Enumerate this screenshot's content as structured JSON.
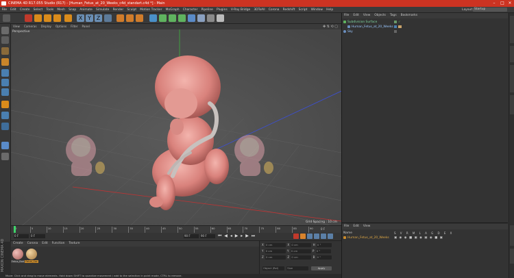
{
  "window": {
    "title": "CINEMA 4D R17.055 Studio (R17) - [Human_Fetus_at_20_Weeks_c4d_standart.c4d *] - Main",
    "buttons": [
      "minimize",
      "maximize",
      "close"
    ]
  },
  "menu": [
    "File",
    "Edit",
    "Create",
    "Select",
    "Tools",
    "Mesh",
    "Snap",
    "Animate",
    "Simulate",
    "Render",
    "Sculpt",
    "Motion Tracker",
    "MoGraph",
    "Character",
    "Pipeline",
    "Plugins",
    "V-Ray Bridge",
    "3DToAll",
    "Corona",
    "Redshift",
    "Script",
    "Window",
    "Help"
  ],
  "layout": {
    "label": "Layout:",
    "value": "Startup"
  },
  "viewport": {
    "menu": [
      "View",
      "Cameras",
      "Display",
      "Options",
      "Filter",
      "Panel"
    ],
    "label": "Perspective",
    "grid_spacing": "Grid Spacing : 10 cm"
  },
  "timeline": {
    "ticks": [
      "0",
      "5",
      "10",
      "15",
      "20",
      "25",
      "30",
      "35",
      "40",
      "45",
      "50",
      "55",
      "60",
      "65",
      "70",
      "75",
      "80",
      "85",
      "90"
    ],
    "end_frame": "0 F"
  },
  "transport": {
    "current": "0 F",
    "start": "0 F",
    "end": "90 F",
    "max": "90 F"
  },
  "object_manager": {
    "menu": [
      "File",
      "Edit",
      "View",
      "Objects",
      "Tags",
      "Bookmarks"
    ],
    "objects": [
      {
        "name": "Subdivision Surface",
        "color": "#7fd6a0"
      },
      {
        "name": "Human_Fetus_at_20_Weeks",
        "color": "#9ac7ff"
      },
      {
        "name": "Sky",
        "color": "#9ac7ff"
      }
    ]
  },
  "attribute_manager": {
    "menu": [
      "File",
      "Edit",
      "View"
    ],
    "header": "Name",
    "columns": [
      "S",
      "V",
      "R",
      "M",
      "L",
      "A",
      "G",
      "D",
      "E",
      "X"
    ],
    "layer_name": "Human_Fetus_at_20_Weeks"
  },
  "side_tabs": [
    "Objects",
    "Takes",
    "Content Browser",
    "Structure",
    "Attributes",
    "Layers"
  ],
  "material_manager": {
    "menu": [
      "Create",
      "Corona",
      "Edit",
      "Function",
      "Texture"
    ],
    "materials": [
      {
        "name": "Fetus_Bod",
        "color": "#c98b86"
      },
      {
        "name": "Fetus_Cor",
        "color": "#c9a36a"
      }
    ]
  },
  "coordinates": {
    "rows": [
      {
        "axis": "X",
        "pos": "0 cm",
        "size_axis": "X",
        "size": "0 cm",
        "rot_axis": "H",
        "rot": "0 °"
      },
      {
        "axis": "Y",
        "pos": "0 cm",
        "size_axis": "Y",
        "size": "0 cm",
        "rot_axis": "P",
        "rot": "0 °"
      },
      {
        "axis": "Z",
        "pos": "0 cm",
        "size_axis": "Z",
        "size": "0 cm",
        "rot_axis": "B",
        "rot": "0 °"
      }
    ],
    "mode": "Object (Rel)",
    "size_mode": "Size",
    "apply": "Apply"
  },
  "brand": {
    "text": "MAXON CINEMA 4D"
  },
  "status": "Move: Click and drag to move elements. Hold down SHIFT to quantize movement / add to the selection in point mode, CTRL to remove."
}
